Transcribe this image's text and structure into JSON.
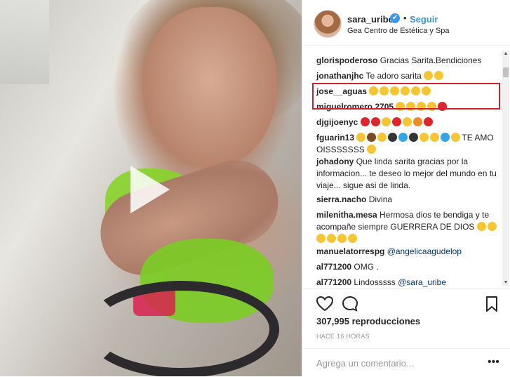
{
  "post": {
    "username": "sara_uribe",
    "verified_symbol": "✔",
    "dot": "•",
    "follow_label": "Seguir",
    "location": "Gea Centro de Estética y Spa"
  },
  "comments": [
    {
      "user": "glorispoderoso",
      "text": "Gracias Sarita.Bendiciones",
      "emojis": []
    },
    {
      "user": "jonathanjhc",
      "text": "Te adoro sarita",
      "emojis": [
        "y",
        "y"
      ]
    },
    {
      "user": "jose__aguas",
      "text": "",
      "emojis": [
        "y",
        "y",
        "y",
        "y",
        "y",
        "y"
      ]
    },
    {
      "user": "miguelromero.2705",
      "text": "",
      "emojis": [
        "y",
        "y",
        "y",
        "y",
        "r"
      ]
    },
    {
      "user": "djgijoenyc",
      "text": "",
      "emojis": [
        "r",
        "r",
        "y",
        "r",
        "y",
        "o",
        "r"
      ]
    },
    {
      "user": "fguarin13",
      "text": "TE AMO OISSSSSSS",
      "emojis": [
        "y",
        "d",
        "y",
        "k",
        "b",
        "k",
        "y",
        "y",
        "b",
        "y"
      ],
      "trailing_emojis": [
        "y"
      ]
    },
    {
      "user": "johadony",
      "text": "Que linda sarita gracias por la informacion... te deseo lo mejor del mundo en tu viaje... sigue asi de linda.",
      "emojis": []
    },
    {
      "user": "sierra.nacho",
      "text": "Divina",
      "emojis": []
    },
    {
      "user": "milenitha.mesa",
      "text": "Hermosa dios te bendiga y te acompañe siempre GUERRERA DE DIOS",
      "emojis": [
        "y",
        "y",
        "y",
        "y",
        "y",
        "y"
      ]
    },
    {
      "user": "manuelatorrespg",
      "text": "",
      "mention": "@angelicaagudelop",
      "emojis": []
    },
    {
      "user": "al771200",
      "text": "OMG .",
      "emojis": []
    },
    {
      "user": "al771200",
      "text": "Lindosssss",
      "mention": "@sara_uribe",
      "emojis": []
    }
  ],
  "stats": {
    "views": "307,995 reproducciones",
    "time_ago": "HACE 16 HORAS"
  },
  "add_comment": {
    "placeholder": "Agrega un comentario...",
    "more": "•••"
  },
  "icons": [
    "play-icon",
    "heart-icon",
    "comment-icon",
    "bookmark-icon",
    "verified-icon"
  ],
  "colors": {
    "link": "#3897f0",
    "highlight": "#d3202e",
    "mention": "#003569"
  }
}
